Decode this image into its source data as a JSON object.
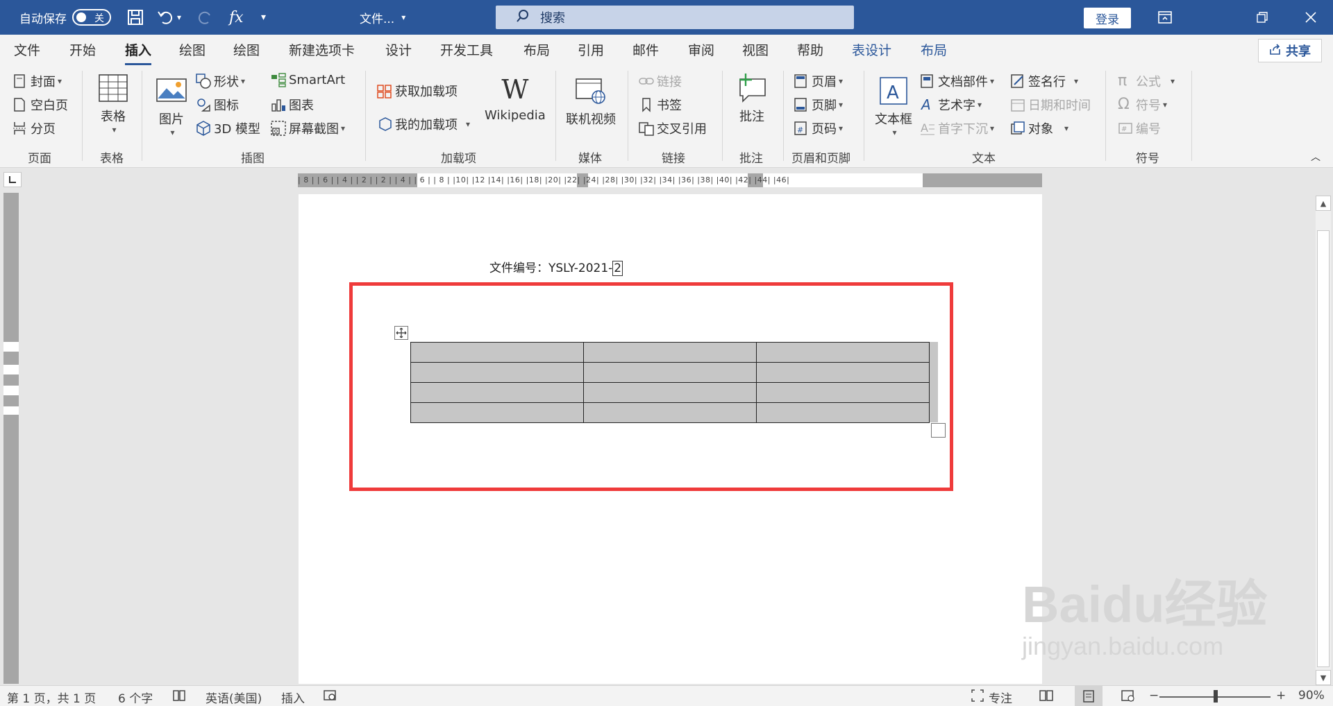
{
  "titlebar": {
    "autosave_label": "自动保存",
    "autosave_state": "关",
    "filename": "文件...",
    "search_placeholder": "搜索",
    "login_label": "登录"
  },
  "menu": {
    "tabs": [
      "文件",
      "开始",
      "插入",
      "绘图",
      "绘图",
      "新建选项卡",
      "设计",
      "开发工具",
      "布局",
      "引用",
      "邮件",
      "审阅",
      "视图",
      "帮助",
      "表设计",
      "布局"
    ],
    "active_tab": "插入",
    "share_label": "共享"
  },
  "ribbon": {
    "pages": {
      "label": "页面",
      "cover": "封面",
      "blank": "空白页",
      "break": "分页"
    },
    "tables": {
      "label": "表格",
      "table": "表格"
    },
    "illustrations": {
      "label": "插图",
      "picture": "图片",
      "shapes": "形状",
      "icons": "图标",
      "model3d": "3D 模型",
      "smartart": "SmartArt",
      "chart": "图表",
      "screenshot": "屏幕截图"
    },
    "addins": {
      "label": "加载项",
      "get": "获取加载项",
      "my": "我的加载项",
      "wikipedia": "Wikipedia"
    },
    "media": {
      "label": "媒体",
      "online_video": "联机视频"
    },
    "links": {
      "label": "链接",
      "link": "链接",
      "bookmark": "书签",
      "crossref": "交叉引用"
    },
    "comments": {
      "label": "批注",
      "comment": "批注"
    },
    "headerfooter": {
      "label": "页眉和页脚",
      "header": "页眉",
      "footer": "页脚",
      "page_number": "页码"
    },
    "text": {
      "label": "文本",
      "textbox": "文本框",
      "quickparts": "文档部件",
      "wordart": "艺术字",
      "dropcap": "首字下沉",
      "signature": "签名行",
      "datetime": "日期和时间",
      "object": "对象"
    },
    "symbols": {
      "label": "符号",
      "equation": "公式",
      "symbol": "符号",
      "number": "编号"
    }
  },
  "ruler": {
    "ticks": "| 8 |   | 6 |   | 4 |   | 2 |        | 2 |   | 4 |   | 6 |   | 8 |   |10|   |12     |14|   |16|   |18|   |20|   |22|   |24|        |28|   |30|   |32|   |34|   |36|   |38|      |40|   |42|   |44|   |46|"
  },
  "document": {
    "file_number_text": "文件编号：YSLY-2021-",
    "cursor_char": "2",
    "table": {
      "rows": 4,
      "cols": 3
    }
  },
  "statusbar": {
    "page": "第 1 页，共 1 页",
    "words": "6 个字",
    "language": "英语(美国)",
    "mode": "插入",
    "focus": "专注",
    "zoom": "90%"
  },
  "watermark": {
    "brand": "Baidu经验",
    "url": "jingyan.baidu.com"
  },
  "colors": {
    "titlebar": "#2b579a",
    "highlight": "#ef3b3b",
    "table_fill": "#c6c6c6"
  }
}
